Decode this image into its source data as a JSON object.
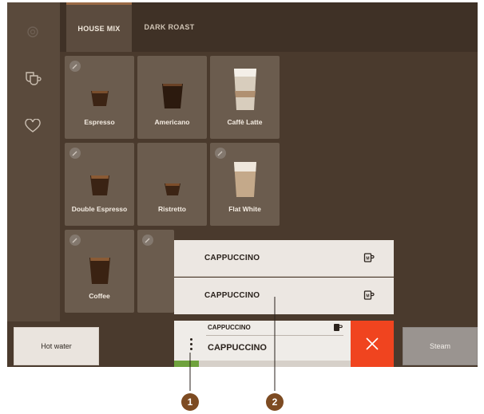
{
  "tabs": {
    "house_mix": "HOUSE MIX",
    "dark_roast": "DARK ROAST"
  },
  "tiles": [
    {
      "label": "Espresso"
    },
    {
      "label": "Americano"
    },
    {
      "label": "Caffè Latte"
    },
    {
      "label": "Double Espresso"
    },
    {
      "label": "Ristretto"
    },
    {
      "label": "Flat White"
    },
    {
      "label": "Coffee"
    }
  ],
  "bottom": {
    "hot_water": "Hot water",
    "steam": "Steam"
  },
  "popup": {
    "items": [
      {
        "label": "CAPPUCCINO",
        "icon": "mug-m-icon"
      },
      {
        "label": "CAPPUCCINO",
        "icon": "mug-m-icon"
      }
    ]
  },
  "current": {
    "small_label": "CAPPUCCINO",
    "main_label": "CAPPUCCINO",
    "close_icon": "close-icon"
  },
  "callouts": {
    "one": "1",
    "two": "2"
  },
  "colors": {
    "accent_red": "#f0441f",
    "progress_green": "#6fa23d",
    "callout_brown": "#7d4b22"
  }
}
